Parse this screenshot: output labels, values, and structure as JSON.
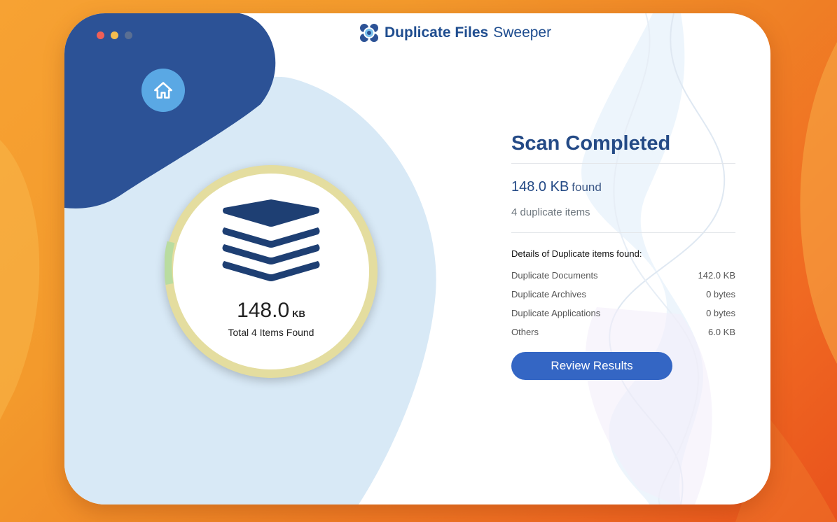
{
  "window": {
    "title_strong": "Duplicate Files",
    "title_light": "Sweeper",
    "traffic_colors": {
      "close": "#ef5f57",
      "minimize": "#f5bd4e",
      "zoom": "#9aa0a8"
    }
  },
  "icons": {
    "home": "home-icon",
    "logo": "app-logo-icon",
    "stack": "layers-stack-icon"
  },
  "summary": {
    "size_value": "148.0",
    "size_unit": "KB",
    "total_text": "Total 4 Items Found"
  },
  "panel": {
    "title": "Scan Completed",
    "found_value": "148.0 KB",
    "found_word": "found",
    "duplicate_count": "4 duplicate items",
    "details_heading": "Details of Duplicate items found:",
    "rows": [
      {
        "label": "Duplicate Documents",
        "value": "142.0 KB"
      },
      {
        "label": "Duplicate Archives",
        "value": "0 bytes"
      },
      {
        "label": "Duplicate Applications",
        "value": "0 bytes"
      },
      {
        "label": "Others",
        "value": "6.0 KB"
      }
    ],
    "review_button": "Review Results"
  },
  "colors": {
    "brand_blue": "#2c5296",
    "light_blue": "#d9eaf7",
    "ring": "#e4dd9f",
    "button": "#3466c4"
  }
}
